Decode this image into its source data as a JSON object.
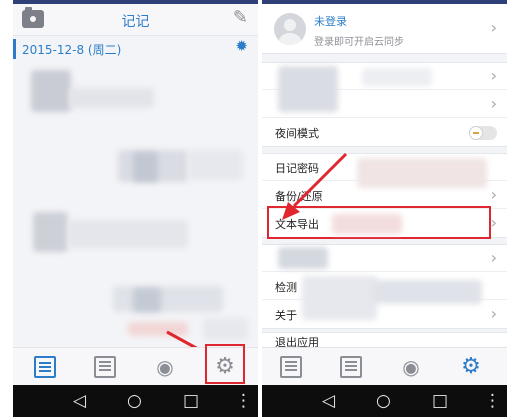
{
  "left_screen": {
    "header": {
      "title": "记记",
      "camera_icon": "camera-icon",
      "edit_icon": "pencil-icon"
    },
    "date_row": {
      "date": "2015-12-8 (周二)",
      "weather_icon": "sun-icon"
    },
    "tab_bar": {
      "icons": [
        "notes-icon",
        "calendar-icon",
        "eye-icon",
        "gear-icon"
      ]
    },
    "nav_bar": {
      "back": "◁",
      "home": "○",
      "recents": "□",
      "menu": "⋮"
    }
  },
  "right_screen": {
    "account": {
      "name": "未登录",
      "subtitle": "登录即可开启云同步"
    },
    "settings": {
      "night_mode": "夜间模式",
      "diary_password": "日记密码",
      "backup_restore": "备份/还原",
      "text_export": "文本导出",
      "check": "检测",
      "about": "关于",
      "exit_app": "退出应用"
    },
    "tab_bar": {
      "icons": [
        "notes-icon",
        "calendar-icon",
        "eye-icon",
        "gear-icon"
      ]
    },
    "nav_bar": {
      "back": "◁",
      "home": "○",
      "recents": "□",
      "menu": "⋮"
    }
  },
  "colors": {
    "accent": "#2c7dc9",
    "highlight": "#e0262f",
    "nav_bar": "#0d0d0d"
  }
}
